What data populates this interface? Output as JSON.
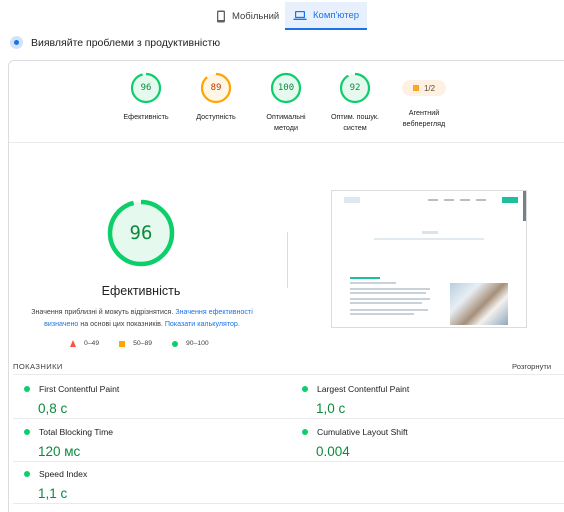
{
  "tabs": {
    "mobile": "Мобільний",
    "desktop": "Комп'ютер"
  },
  "header": {
    "title": "Виявляйте проблеми з продуктивністю"
  },
  "gauges": [
    {
      "value": "96",
      "label": "Ефективність",
      "status": "good",
      "color": "#0cce6b"
    },
    {
      "value": "89",
      "label": "Доступність",
      "status": "average",
      "color": "#ffa400"
    },
    {
      "value": "100",
      "label": "Оптимальні методи",
      "status": "good",
      "color": "#0cce6b"
    },
    {
      "value": "92",
      "label": "Оптим. пошук. систем",
      "status": "good",
      "color": "#0cce6b"
    }
  ],
  "pwa": {
    "badge": "1/2",
    "label": "Агентний вебперегляд"
  },
  "performance": {
    "score": "96",
    "title": "Ефективність",
    "note_pre": "Значення приблизні й можуть відрізнятися.",
    "note_link1": "Значення ефективності визначено",
    "note_mid": "на основі цих показників.",
    "note_link2": "Показати калькулятор."
  },
  "legend": {
    "red": "0–49",
    "orange": "50–89",
    "green": "90–100"
  },
  "metrics": {
    "heading": "ПОКАЗНИКИ",
    "expand": "Розгорнути",
    "items": {
      "fcp": {
        "label": "First Contentful Paint",
        "value": "0,8 с"
      },
      "lcp": {
        "label": "Largest Contentful Paint",
        "value": "1,0 с"
      },
      "tbt": {
        "label": "Total Blocking Time",
        "value": "120 мс"
      },
      "cls": {
        "label": "Cumulative Layout Shift",
        "value": "0.004"
      },
      "si": {
        "label": "Speed Index",
        "value": "1,1 с"
      }
    }
  },
  "colors": {
    "accent": "#1a73e8",
    "good": "#0cce6b",
    "average": "#ffa400",
    "poor": "#ff4e42"
  }
}
